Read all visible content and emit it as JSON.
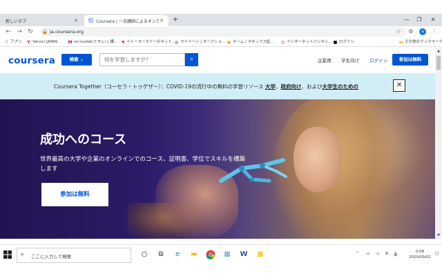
{
  "browser": {
    "tabs": [
      {
        "label": "新しいタブ",
        "active": false
      },
      {
        "label": "Coursera | 一流講師によるオンライ",
        "active": true
      }
    ],
    "new_tab": "+",
    "window_controls": {
      "minimize": "—",
      "maximize": "❐",
      "close": "✕"
    },
    "url": "ja.coursera.org"
  },
  "bookmarks": [
    {
      "label": "アプリ",
      "icon": "apps-grid-icon"
    },
    {
      "label": "Yahoo! JAPAN",
      "icon": "yahoo-icon"
    },
    {
      "label": "mi-mollet(ミモレ) | 講...",
      "icon": "mimollet-icon"
    },
    {
      "label": "イトーヨーカドーのネット...",
      "icon": "itoyokado-icon"
    },
    {
      "label": "マイページ | オークショ...",
      "icon": "globe-icon"
    },
    {
      "label": "ホーム / マネックス証...",
      "icon": "monex-icon"
    },
    {
      "label": "インターネットバンキン...",
      "icon": "bank-icon"
    },
    {
      "label": "ログイン",
      "icon": "login-icon"
    },
    {
      "label": "その他のブックマーク",
      "icon": "folder-icon"
    }
  ],
  "header": {
    "logo": "coursera",
    "explore_label": "検索 ⌄",
    "search_placeholder": "何を学習しますか？",
    "links": {
      "enterprise": "企業用",
      "student": "学生向け",
      "login": "ログイン"
    },
    "signup_label": "参加は無料"
  },
  "banner": {
    "text_prefix": "Coursera Together（コーセラ・トゥゲザー）：COVID-19の流行中の無料の学習リソース ",
    "link1": "大学",
    "sep1": "、",
    "link2": "政府向け",
    "sep2": "、および",
    "link3": "大学生のための",
    "close": "✕"
  },
  "hero": {
    "title": "成功へのコース",
    "subtitle": "世界最高の大学や企業のオンラインでのコース、証明書、学位でスキルを構築します",
    "cta_label": "参加は無料"
  },
  "taskbar": {
    "search_text": "ここに入力して検索",
    "time": "0:08",
    "date": "2020/09/02",
    "ime": "あ",
    "lang": "A"
  },
  "colors": {
    "brand": "#0056d2",
    "banner_bg": "#d1eef6",
    "hero_dark": "#221452"
  }
}
